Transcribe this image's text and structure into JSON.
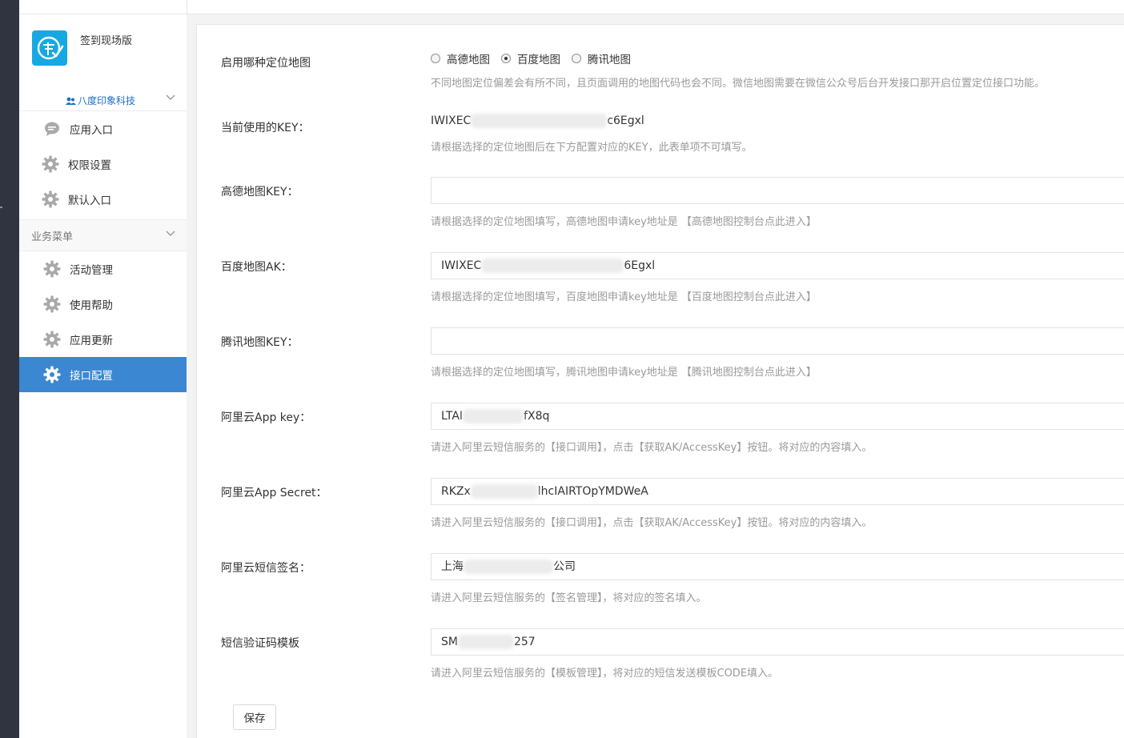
{
  "sidebar": {
    "app_name": "签到现场版",
    "company": "八度印象科技",
    "top_items": [
      {
        "label": "应用入口",
        "icon": "chat-bubble-icon"
      },
      {
        "label": "权限设置",
        "icon": "gear-icon"
      },
      {
        "label": "默认入口",
        "icon": "gear-icon"
      }
    ],
    "section_title": "业务菜单",
    "section_items": [
      {
        "label": "活动管理",
        "icon": "gear-icon"
      },
      {
        "label": "使用帮助",
        "icon": "gear-icon"
      },
      {
        "label": "应用更新",
        "icon": "gear-icon"
      },
      {
        "label": "接口配置",
        "icon": "gear-icon",
        "active": true
      }
    ]
  },
  "form": {
    "map_select": {
      "label": "启用哪种定位地图",
      "options": [
        "高德地图",
        "百度地图",
        "腾讯地图"
      ],
      "selected": "百度地图",
      "help": "不同地图定位偏差会有所不同，且页面调用的地图代码也会不同。微信地图需要在微信公众号后台开发接口那开启位置定位接口功能。"
    },
    "current_key": {
      "label": "当前使用的KEY：",
      "value_prefix": "IWIXEC",
      "value_suffix": "c6Egxl",
      "help": "请根据选择的定位地图后在下方配置对应的KEY，此表单项不可填写。"
    },
    "gaode_key": {
      "label": "高德地图KEY：",
      "value": "",
      "help": "请根据选择的定位地图填写，高德地图申请key地址是 【高德地图控制台点此进入】"
    },
    "baidu_ak": {
      "label": "百度地图AK：",
      "value_prefix": "IWIXEC",
      "value_suffix": "6Egxl",
      "help": "请根据选择的定位地图填写，百度地图申请key地址是 【百度地图控制台点此进入】"
    },
    "tencent_key": {
      "label": "腾讯地图KEY：",
      "value": "",
      "help": "请根据选择的定位地图填写，腾讯地图申请key地址是 【腾讯地图控制台点此进入】"
    },
    "aliyun_key": {
      "label": "阿里云App key：",
      "value_prefix": "LTAI",
      "value_suffix": "fX8q",
      "help": "请进入阿里云短信服务的【接口调用】，点击【获取AK/AccessKey】按钮。将对应的内容填入。"
    },
    "aliyun_secret": {
      "label": "阿里云App Secret：",
      "value_prefix": "RKZx",
      "value_suffix": "lhcIAIRTOpYMDWeA",
      "help": "请进入阿里云短信服务的【接口调用】，点击【获取AK/AccessKey】按钮。将对应的内容填入。"
    },
    "aliyun_sign": {
      "label": "阿里云短信签名：",
      "value_prefix": "上海",
      "value_suffix": "公司",
      "help": "请进入阿里云短信服务的【签名管理】，将对应的签名填入。"
    },
    "sms_template": {
      "label": "短信验证码模板",
      "value_prefix": "SM",
      "value_suffix": "257",
      "help": "请进入阿里云短信服务的【模板管理】，将对应的短信发送模板CODE填入。"
    },
    "save_label": "保存"
  }
}
